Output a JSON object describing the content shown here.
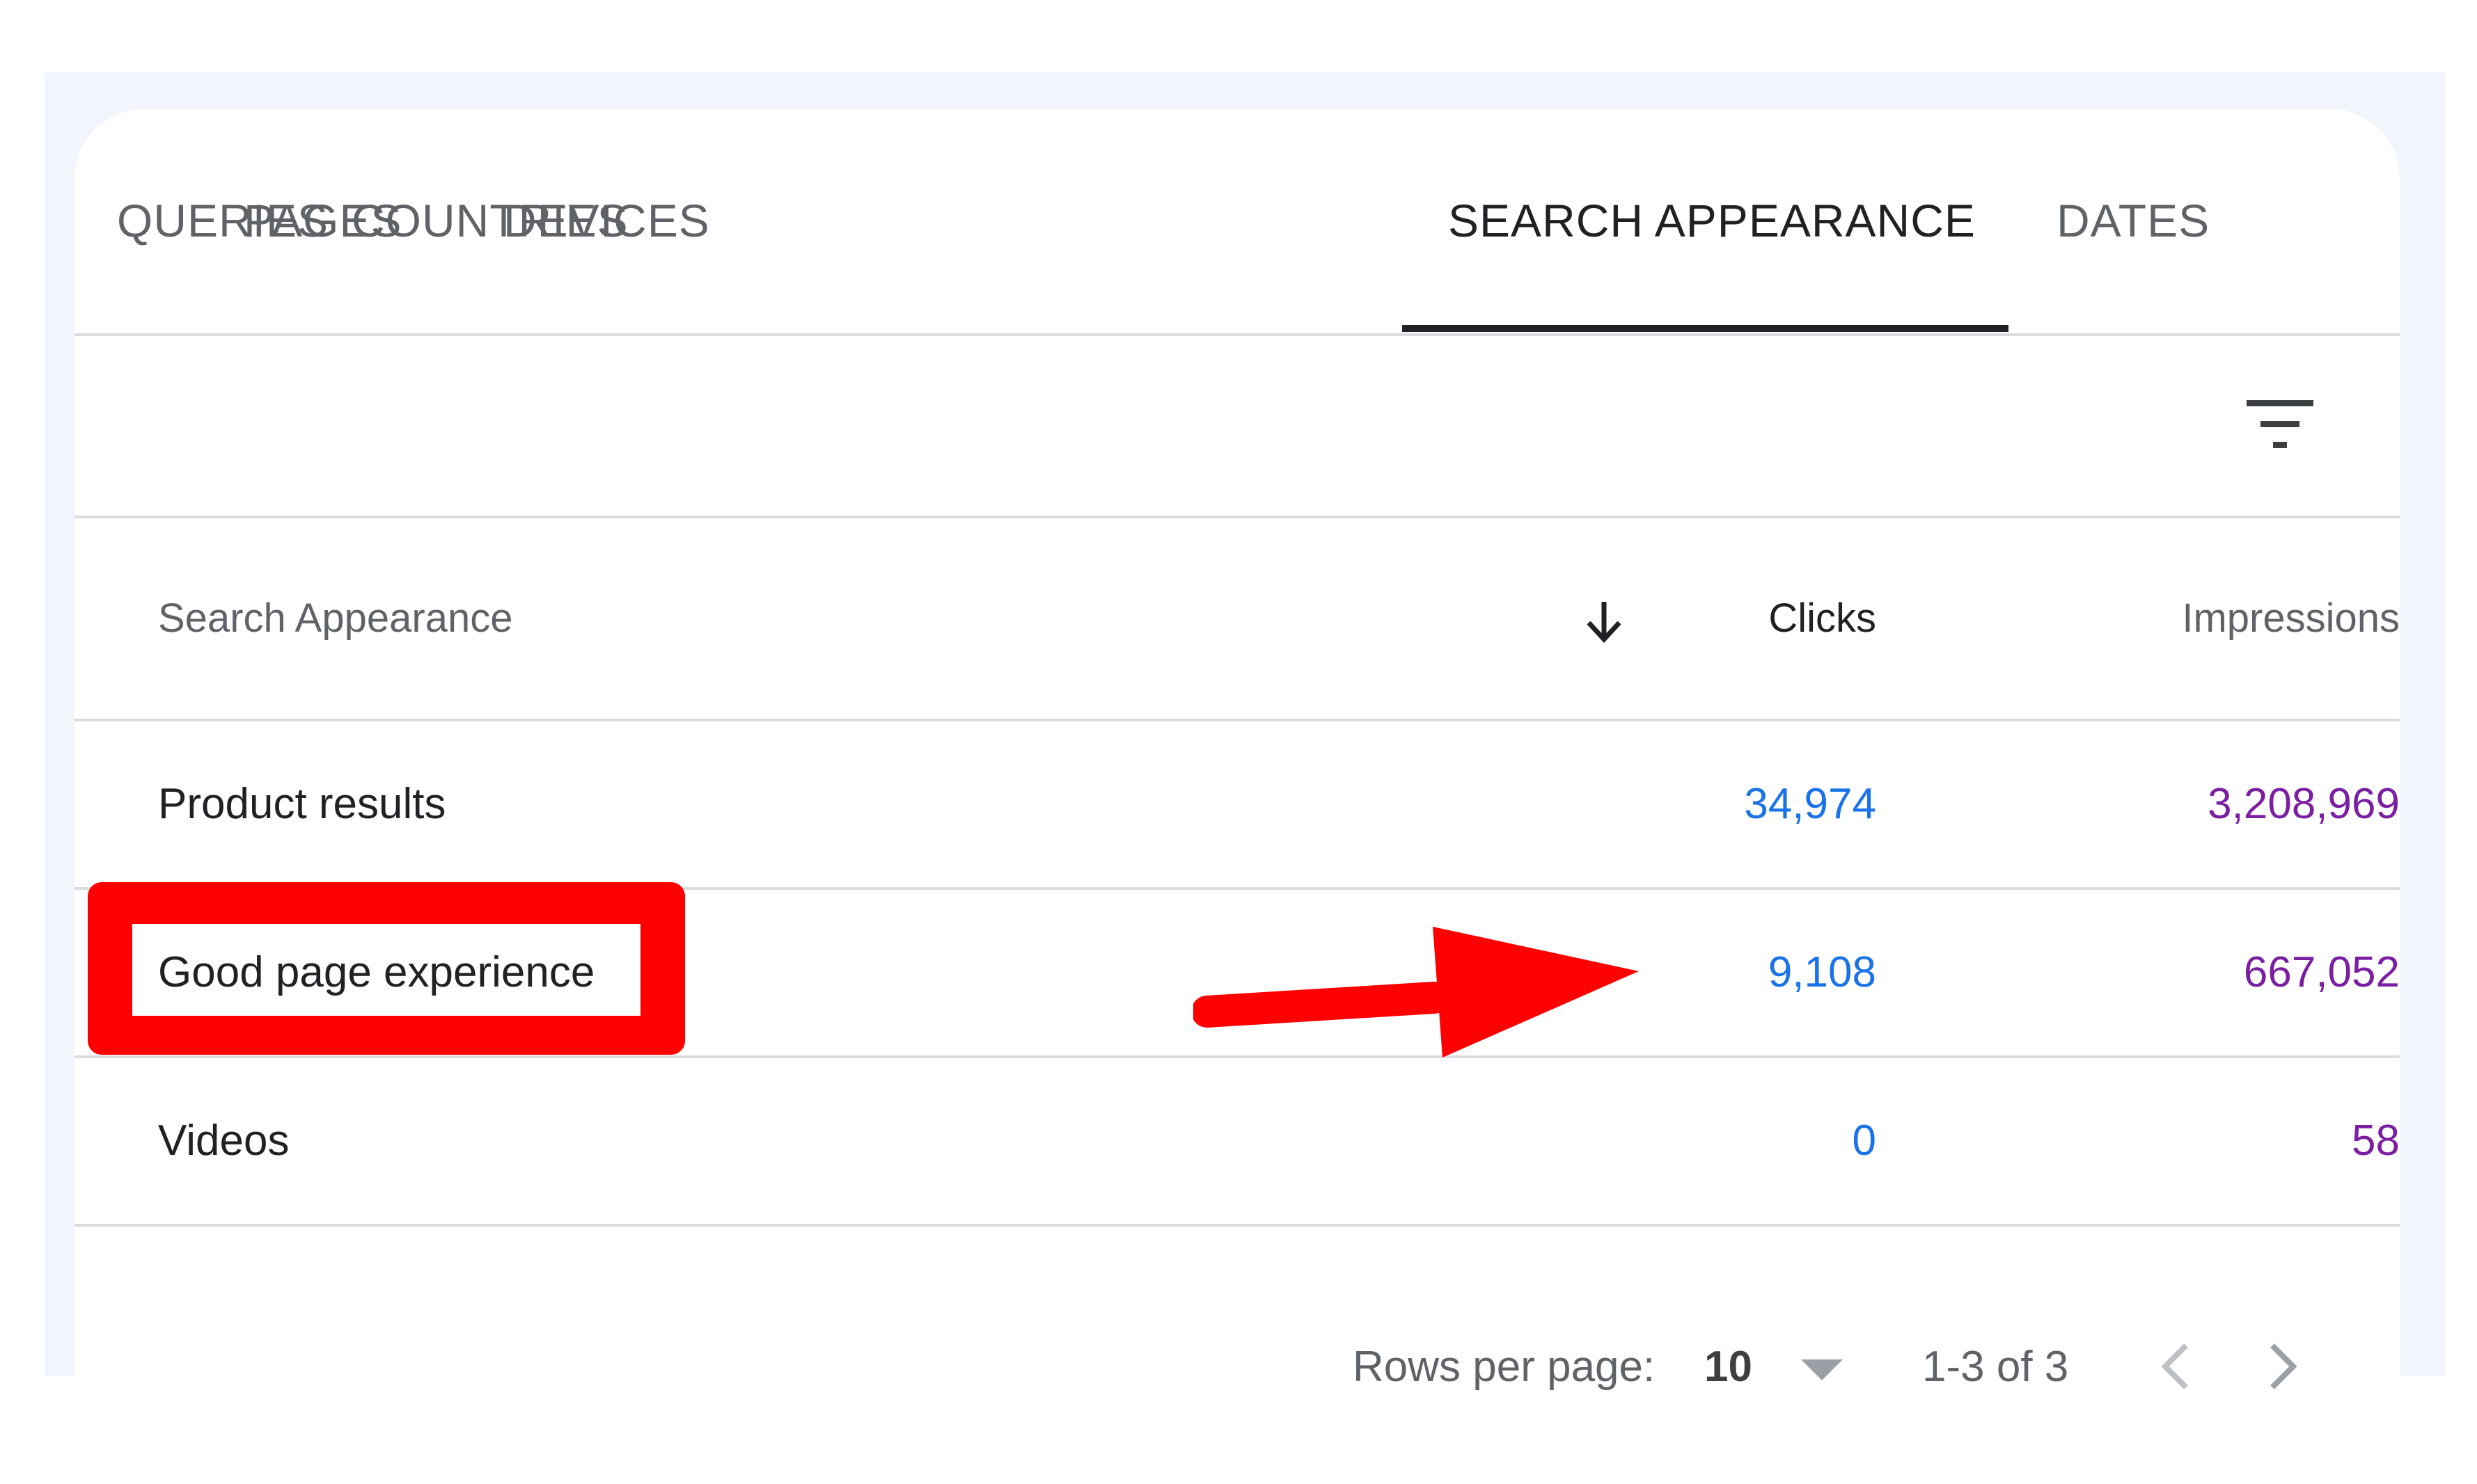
{
  "tabs": [
    {
      "label": "QUERIES",
      "active": false
    },
    {
      "label": "PAGES",
      "active": false
    },
    {
      "label": "COUNTRIES",
      "active": false
    },
    {
      "label": "DEVICES",
      "active": false
    },
    {
      "label": "SEARCH APPEARANCE",
      "active": true
    },
    {
      "label": "DATES",
      "active": false
    }
  ],
  "filter": {
    "icon": "filter-list-icon"
  },
  "table": {
    "headers": {
      "name": "Search Appearance",
      "clicks": "Clicks",
      "impressions": "Impressions"
    },
    "sort_icon": "arrow-down-icon",
    "rows": [
      {
        "name": "Product results",
        "clicks": "34,974",
        "impressions": "3,208,969"
      },
      {
        "name": "Good page experience",
        "clicks": "9,108",
        "impressions": "667,052"
      },
      {
        "name": "Videos",
        "clicks": "0",
        "impressions": "58"
      }
    ]
  },
  "pagination": {
    "rows_per_page_label": "Rows per page:",
    "rows_per_page_value": "10",
    "range": "1-3 of 3",
    "prev_icon": "chevron-left-icon",
    "next_icon": "chevron-right-icon"
  },
  "colors": {
    "clicks": "#1a73e8",
    "impressions": "#7b1fa2",
    "annotation": "#ff0000",
    "active_tab": "#202124",
    "inactive_tab": "#5f6368"
  }
}
